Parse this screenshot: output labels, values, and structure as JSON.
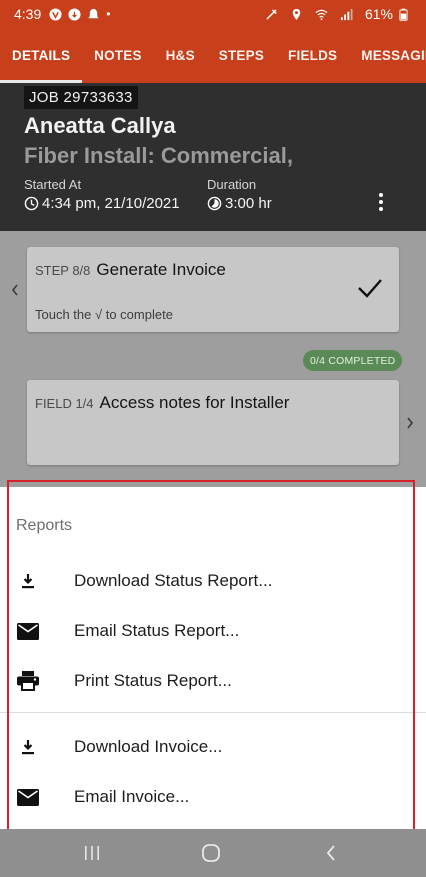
{
  "status_bar": {
    "time": "4:39",
    "battery": "61%"
  },
  "tabs": [
    {
      "label": "DETAILS",
      "active": true
    },
    {
      "label": "NOTES",
      "active": false
    },
    {
      "label": "H&S",
      "active": false
    },
    {
      "label": "STEPS",
      "active": false
    },
    {
      "label": "FIELDS",
      "active": false
    },
    {
      "label": "MESSAGING",
      "active": false
    }
  ],
  "header": {
    "job_number": "JOB 29733633",
    "customer": "Aneatta Callya",
    "job_type": "Fiber Install: Commercial,",
    "started_label": "Started At",
    "started_value": "4:34 pm, 21/10/2021",
    "duration_label": "Duration",
    "duration_value": "3:00 hr"
  },
  "step_card": {
    "prefix": "STEP 8/8",
    "title": "Generate Invoice",
    "hint": "Touch the √ to complete"
  },
  "completed_badge": "0/4 COMPLETED",
  "field_card": {
    "prefix": "FIELD 1/4",
    "title": "Access notes for Installer"
  },
  "reports_sheet": {
    "title": "Reports",
    "items": [
      {
        "label": "Download Status Report...",
        "icon": "download-icon"
      },
      {
        "label": "Email Status Report...",
        "icon": "email-icon"
      },
      {
        "label": "Print Status Report...",
        "icon": "print-icon"
      },
      {
        "label": "Download Invoice...",
        "icon": "download-icon"
      },
      {
        "label": "Email Invoice...",
        "icon": "email-icon"
      }
    ]
  },
  "colors": {
    "brand": "#c7401b",
    "header_bg": "#2f2f2f",
    "badge_green": "#5a8a55",
    "highlight": "#d6202a"
  }
}
